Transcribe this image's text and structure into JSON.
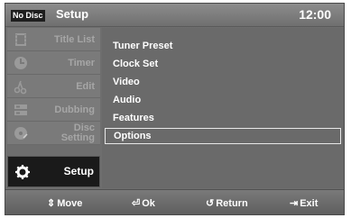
{
  "header": {
    "disc_status": "No Disc",
    "title": "Setup",
    "clock": "12:00"
  },
  "sidebar": {
    "items": [
      {
        "label": "Title List",
        "icon": "film-icon",
        "active": false
      },
      {
        "label": "Timer",
        "icon": "timer-icon",
        "active": false
      },
      {
        "label": "Edit",
        "icon": "scissors-icon",
        "active": false
      },
      {
        "label": "Dubbing",
        "icon": "dubbing-icon",
        "active": false
      },
      {
        "label_line1": "Disc",
        "label_line2": "Setting",
        "icon": "disc-icon",
        "active": false
      },
      {
        "label": "Setup",
        "icon": "gear-icon",
        "active": true
      }
    ]
  },
  "menu": {
    "items": [
      "Tuner Preset",
      "Clock Set",
      "Video",
      "Audio",
      "Features",
      "Options"
    ],
    "selected_index": 5
  },
  "footer": {
    "move_label": "Move",
    "ok_label": "Ok",
    "return_label": "Return",
    "exit_label": "Exit"
  },
  "colors": {
    "panel": "#6e6e6e",
    "active_item": "#1a1a1a",
    "text": "#ffffff",
    "inactive_text": "#a6a6a6"
  }
}
